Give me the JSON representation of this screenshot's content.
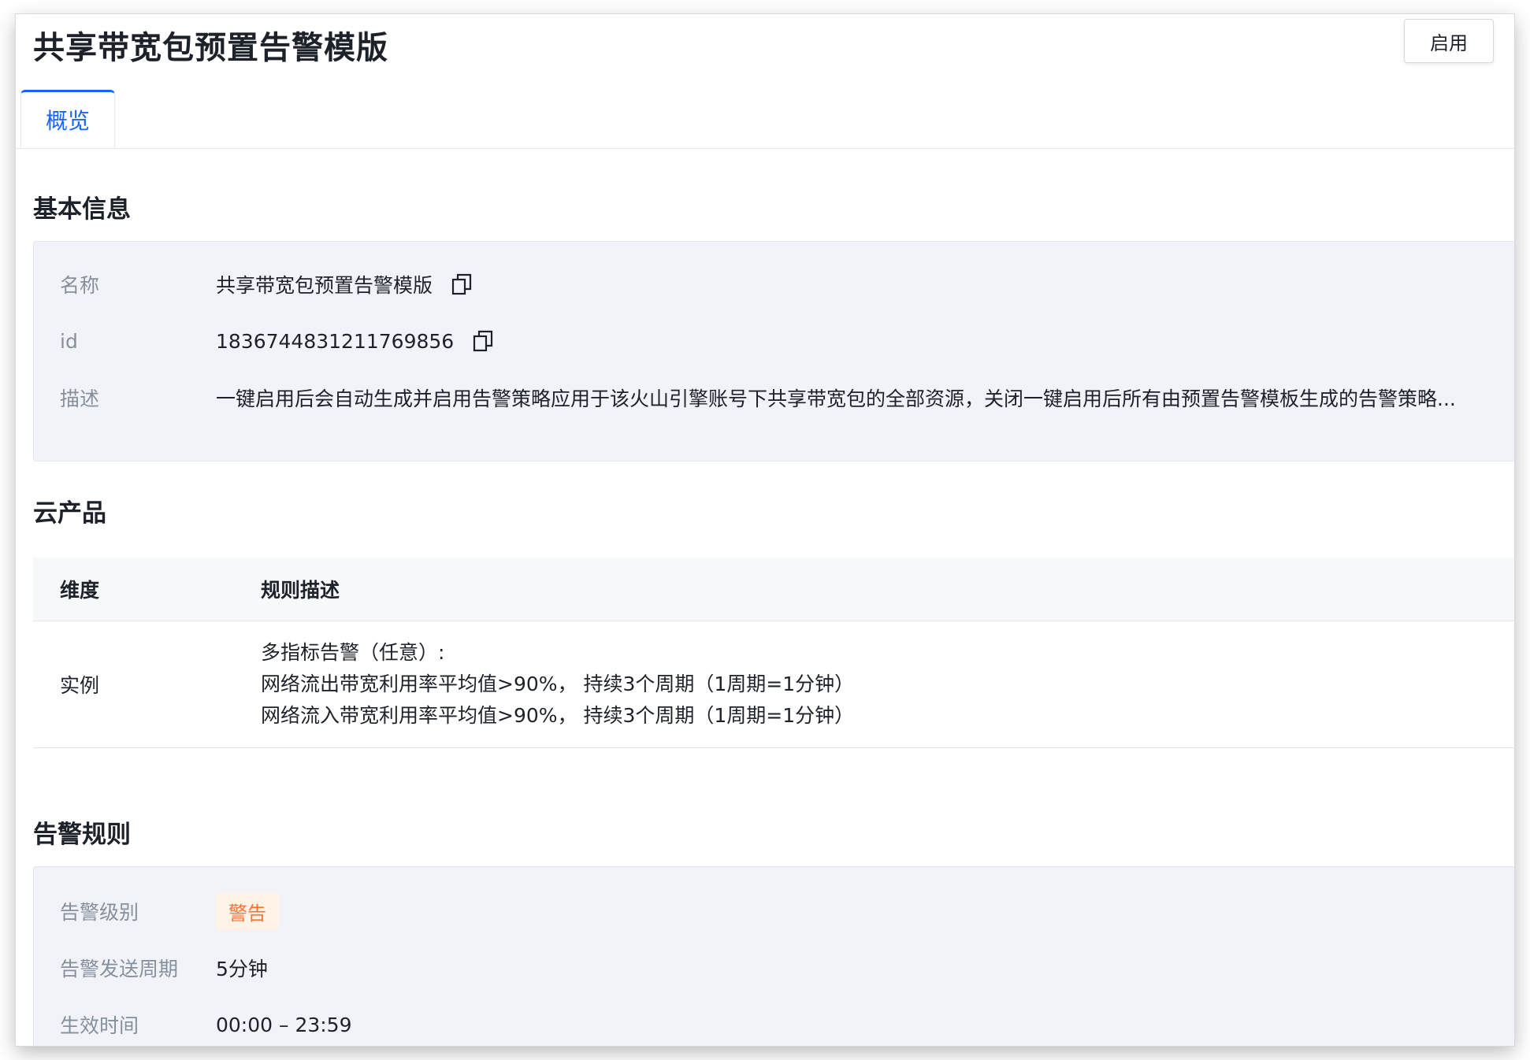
{
  "header": {
    "title": "共享带宽包预置告警模版",
    "enable_label": "启用"
  },
  "tabs": [
    {
      "label": "概览",
      "active": true
    }
  ],
  "basic_info": {
    "section_title": "基本信息",
    "rows": [
      {
        "label": "名称",
        "value": "共享带宽包预置告警模版",
        "copy_icon": "copy-icon"
      },
      {
        "label": "id",
        "value": "1836744831211769856",
        "copy_icon": "copy-icon"
      },
      {
        "label": "描述",
        "value": "一键启用后会自动生成并启用告警策略应用于该火山引擎账号下共享带宽包的全部资源，关闭一键启用后所有由预置告警模板生成的告警策略..."
      }
    ]
  },
  "cloud_product": {
    "section_title": "云产品",
    "columns": [
      "维度",
      "规则描述"
    ],
    "rows": [
      {
        "dimension": "实例",
        "rules": [
          "多指标告警（任意）:",
          "网络流出带宽利用率平均值>90%， 持续3个周期（1周期=1分钟）",
          "网络流入带宽利用率平均值>90%， 持续3个周期（1周期=1分钟）"
        ]
      }
    ]
  },
  "alert_rules": {
    "section_title": "告警规则",
    "level_label": "告警级别",
    "level_value": "警告",
    "period_label": "告警发送周期",
    "period_value": "5分钟",
    "time_label": "生效时间",
    "time_value": "00:00 – 23:59"
  },
  "colors": {
    "accent": "#1664ff",
    "panel_bg": "#f2f3f8",
    "label": "#86909c",
    "badge_bg": "#fff3e8",
    "badge_text": "#f77234"
  }
}
